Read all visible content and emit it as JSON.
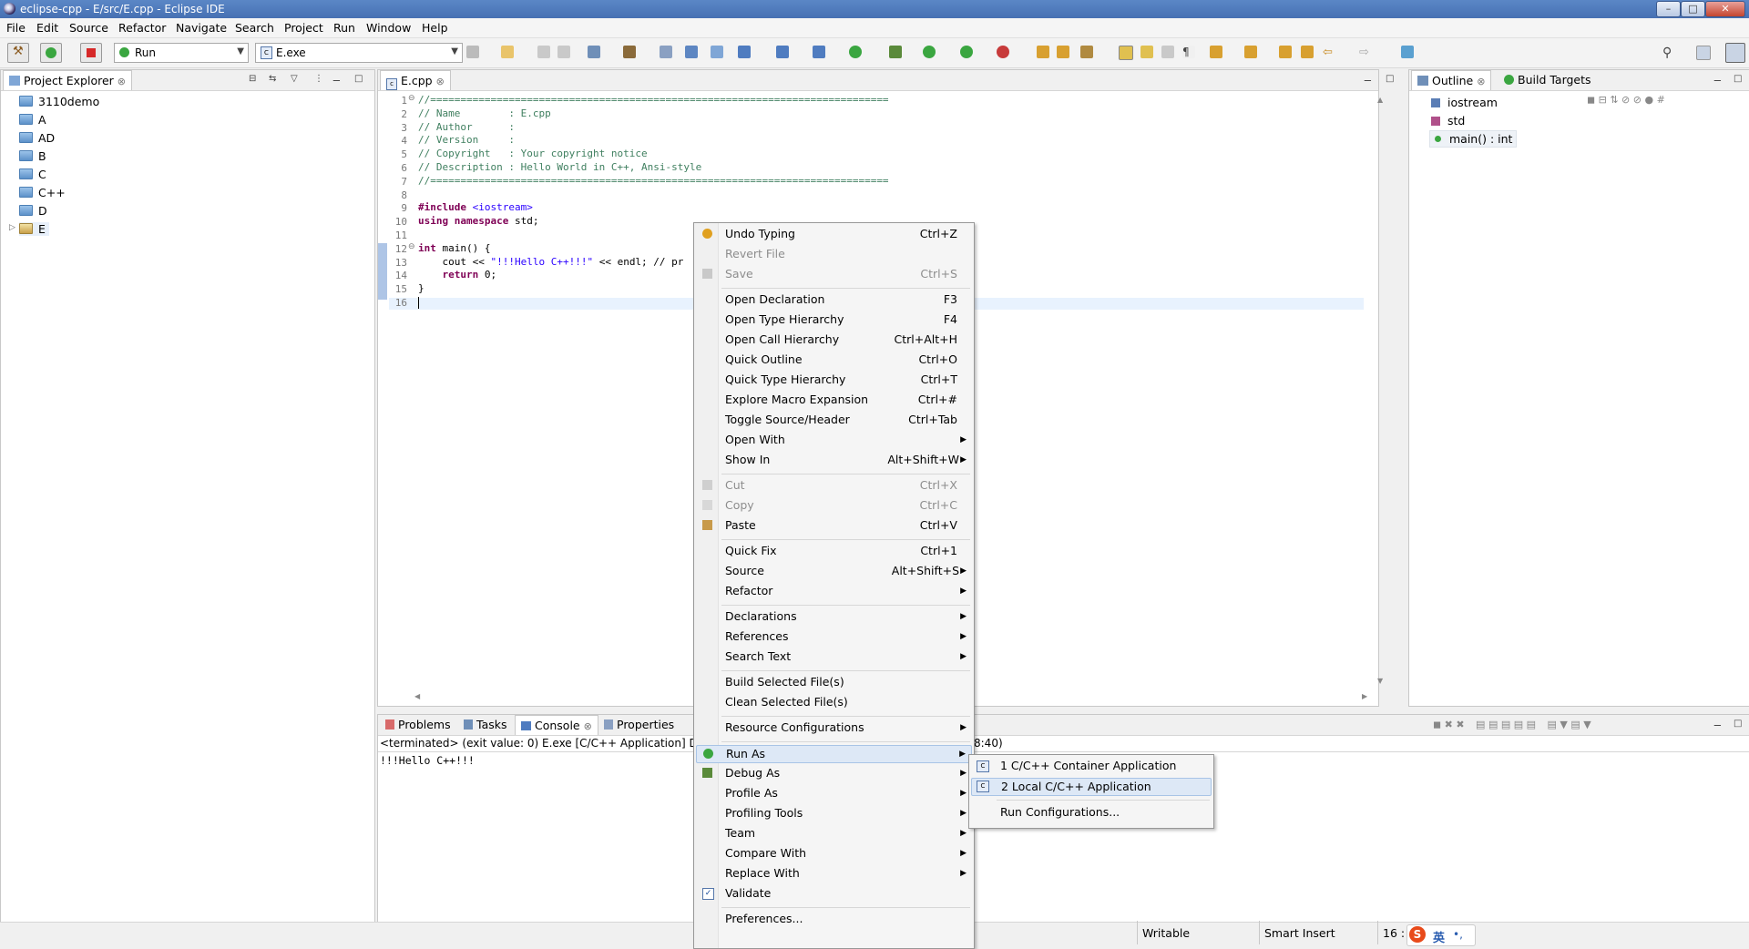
{
  "window": {
    "title": "eclipse-cpp - E/src/E.cpp - Eclipse IDE"
  },
  "menubar": [
    "File",
    "Edit",
    "Source",
    "Refactor",
    "Navigate",
    "Search",
    "Project",
    "Run",
    "Window",
    "Help"
  ],
  "toolbar": {
    "launch_mode": "Run",
    "launch_config": "E.exe"
  },
  "project_explorer": {
    "tab_label": "Project Explorer",
    "projects": [
      "3110demo",
      "A",
      "AD",
      "B",
      "C",
      "C++",
      "D",
      "E"
    ],
    "expand_marker": "▷"
  },
  "editor": {
    "tab_label": "E.cpp",
    "lines": [
      {
        "n": "1",
        "fold": "⊖",
        "text": "//============================================================================",
        "cls": "cm"
      },
      {
        "n": "2",
        "fold": "",
        "text": "// Name        : E.cpp",
        "cls": "cm"
      },
      {
        "n": "3",
        "fold": "",
        "text": "// Author      :",
        "cls": "cm"
      },
      {
        "n": "4",
        "fold": "",
        "text": "// Version     :",
        "cls": "cm"
      },
      {
        "n": "5",
        "fold": "",
        "text": "// Copyright   : Your copyright notice",
        "cls": "cm"
      },
      {
        "n": "6",
        "fold": "",
        "text": "// Description : Hello World in C++, Ansi-style",
        "cls": "cm"
      },
      {
        "n": "7",
        "fold": "",
        "text": "//============================================================================",
        "cls": "cm"
      },
      {
        "n": "8",
        "fold": "",
        "text": "",
        "cls": ""
      },
      {
        "n": "9",
        "fold": "",
        "text": "",
        "cls": "include"
      },
      {
        "n": "10",
        "fold": "",
        "text": "",
        "cls": "using"
      },
      {
        "n": "11",
        "fold": "",
        "text": "",
        "cls": ""
      },
      {
        "n": "12",
        "fold": "⊖",
        "text": "",
        "cls": "main"
      },
      {
        "n": "13",
        "fold": "",
        "text": "",
        "cls": "cout"
      },
      {
        "n": "14",
        "fold": "",
        "text": "",
        "cls": "ret"
      },
      {
        "n": "15",
        "fold": "",
        "text": "}",
        "cls": ""
      },
      {
        "n": "16",
        "fold": "",
        "text": "",
        "cls": ""
      }
    ],
    "include_kw": "#include",
    "include_hdr": "<iostream>",
    "using_kw": "using namespace",
    "using_rest": " std;",
    "main_kw": "int",
    "main_rest": " main() {",
    "cout_a": "    cout << ",
    "cout_str": "\"!!!Hello C++!!!\"",
    "cout_b": " << endl; // pr",
    "ret_kw": "    return",
    "ret_rest": " 0;"
  },
  "outline": {
    "tabs": [
      "Outline",
      "Build Targets"
    ],
    "items": [
      "iostream",
      "std",
      "main() : int"
    ]
  },
  "console": {
    "tabs": [
      "Problems",
      "Tasks",
      "Console",
      "Properties"
    ],
    "header": "<terminated> (exit value: 0) E.exe [C/C++ Application] D:\\w",
    "header_tail": "8:40)",
    "output": "!!!Hello C++!!!"
  },
  "context_menu": {
    "items": [
      {
        "label": "Undo Typing",
        "shortcut": "Ctrl+Z",
        "disabled": false,
        "sub": false,
        "icon": "undo-icon"
      },
      {
        "label": "Revert File",
        "shortcut": "",
        "disabled": true,
        "sub": false,
        "icon": ""
      },
      {
        "label": "Save",
        "shortcut": "Ctrl+S",
        "disabled": true,
        "sub": false,
        "icon": "save-icon"
      },
      {
        "sep": true
      },
      {
        "label": "Open Declaration",
        "shortcut": "F3",
        "disabled": false,
        "sub": false
      },
      {
        "label": "Open Type Hierarchy",
        "shortcut": "F4",
        "disabled": false,
        "sub": false
      },
      {
        "label": "Open Call Hierarchy",
        "shortcut": "Ctrl+Alt+H",
        "disabled": false,
        "sub": false
      },
      {
        "label": "Quick Outline",
        "shortcut": "Ctrl+O",
        "disabled": false,
        "sub": false
      },
      {
        "label": "Quick Type Hierarchy",
        "shortcut": "Ctrl+T",
        "disabled": false,
        "sub": false
      },
      {
        "label": "Explore Macro Expansion",
        "shortcut": "Ctrl+#",
        "disabled": false,
        "sub": false
      },
      {
        "label": "Toggle Source/Header",
        "shortcut": "Ctrl+Tab",
        "disabled": false,
        "sub": false
      },
      {
        "label": "Open With",
        "shortcut": "",
        "disabled": false,
        "sub": true
      },
      {
        "label": "Show In",
        "shortcut": "Alt+Shift+W",
        "disabled": false,
        "sub": true
      },
      {
        "sep": true
      },
      {
        "label": "Cut",
        "shortcut": "Ctrl+X",
        "disabled": true,
        "sub": false,
        "icon": "cut-icon"
      },
      {
        "label": "Copy",
        "shortcut": "Ctrl+C",
        "disabled": true,
        "sub": false,
        "icon": "copy-icon"
      },
      {
        "label": "Paste",
        "shortcut": "Ctrl+V",
        "disabled": false,
        "sub": false,
        "icon": "paste-icon"
      },
      {
        "sep": true
      },
      {
        "label": "Quick Fix",
        "shortcut": "Ctrl+1",
        "disabled": false,
        "sub": false
      },
      {
        "label": "Source",
        "shortcut": "Alt+Shift+S",
        "disabled": false,
        "sub": true
      },
      {
        "label": "Refactor",
        "shortcut": "",
        "disabled": false,
        "sub": true
      },
      {
        "sep": true
      },
      {
        "label": "Declarations",
        "shortcut": "",
        "disabled": false,
        "sub": true
      },
      {
        "label": "References",
        "shortcut": "",
        "disabled": false,
        "sub": true
      },
      {
        "label": "Search Text",
        "shortcut": "",
        "disabled": false,
        "sub": true
      },
      {
        "sep": true
      },
      {
        "label": "Build Selected File(s)",
        "shortcut": "",
        "disabled": false,
        "sub": false
      },
      {
        "label": "Clean Selected File(s)",
        "shortcut": "",
        "disabled": false,
        "sub": false
      },
      {
        "sep": true
      },
      {
        "label": "Resource Configurations",
        "shortcut": "",
        "disabled": false,
        "sub": true
      },
      {
        "sep": true
      },
      {
        "label": "Run As",
        "shortcut": "",
        "disabled": false,
        "sub": true,
        "icon": "run-icon",
        "hl": true
      },
      {
        "label": "Debug As",
        "shortcut": "",
        "disabled": false,
        "sub": true,
        "icon": "debug-icon"
      },
      {
        "label": "Profile As",
        "shortcut": "",
        "disabled": false,
        "sub": true
      },
      {
        "label": "Profiling Tools",
        "shortcut": "",
        "disabled": false,
        "sub": true
      },
      {
        "label": "Team",
        "shortcut": "",
        "disabled": false,
        "sub": true
      },
      {
        "label": "Compare With",
        "shortcut": "",
        "disabled": false,
        "sub": true
      },
      {
        "label": "Replace With",
        "shortcut": "",
        "disabled": false,
        "sub": true
      },
      {
        "label": "Validate",
        "shortcut": "",
        "disabled": false,
        "sub": false,
        "icon": "check-icon"
      },
      {
        "sep": true
      },
      {
        "label": "Preferences...",
        "shortcut": "",
        "disabled": false,
        "sub": false
      }
    ]
  },
  "run_as_submenu": {
    "items": [
      "1 C/C++ Container Application",
      "2 Local C/C++ Application",
      "Run Configurations..."
    ]
  },
  "statusbar": {
    "writable": "Writable",
    "insert_mode": "Smart Insert",
    "position": "16 :",
    "ime_label": "英"
  }
}
